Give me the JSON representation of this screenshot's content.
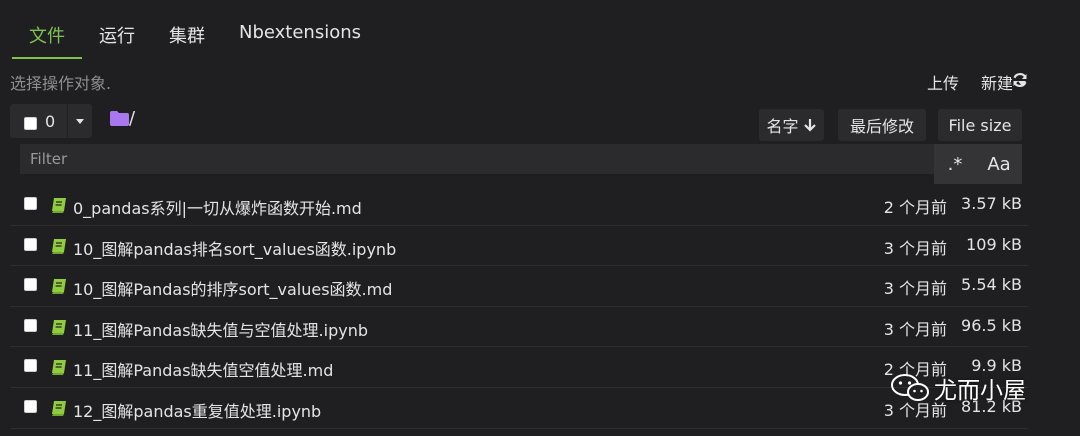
{
  "tabs": [
    {
      "label": "文件",
      "active": true
    },
    {
      "label": "运行",
      "active": false
    },
    {
      "label": "集群",
      "active": false
    },
    {
      "label": "Nbextensions",
      "active": false
    }
  ],
  "toolbar": {
    "hint": "选择操作对象.",
    "upload_label": "上传",
    "new_label": "新建",
    "refresh_icon": "refresh-icon",
    "selected_count": "0",
    "path": "/"
  },
  "sort": {
    "name_label": "名字",
    "modified_label": "最后修改",
    "size_label": "File size"
  },
  "filter": {
    "placeholder": "Filter",
    "regex_label": ".*",
    "case_label": "Aa"
  },
  "files": [
    {
      "name": "0_pandas系列|一切从爆炸函数开始.md",
      "modified": "2 个月前",
      "size": "3.57 kB"
    },
    {
      "name": "10_图解pandas排名sort_values函数.ipynb",
      "modified": "3 个月前",
      "size": "109 kB"
    },
    {
      "name": "10_图解Pandas的排序sort_values函数.md",
      "modified": "3 个月前",
      "size": "5.54 kB"
    },
    {
      "name": "11_图解Pandas缺失值与空值处理.ipynb",
      "modified": "3 个月前",
      "size": "96.5 kB"
    },
    {
      "name": "11_图解Pandas缺失值空值处理.md",
      "modified": "2 个月前",
      "size": "9.9 kB"
    },
    {
      "name": "12_图解pandas重复值处理.ipynb",
      "modified": "3 个月前",
      "size": "81.2 kB"
    }
  ],
  "watermark": {
    "text": "尤而小屋"
  },
  "colors": {
    "accent": "#7fc24f",
    "background": "#1f1f21",
    "folder": "#a978f0",
    "notebook": "#8fcc3f"
  }
}
